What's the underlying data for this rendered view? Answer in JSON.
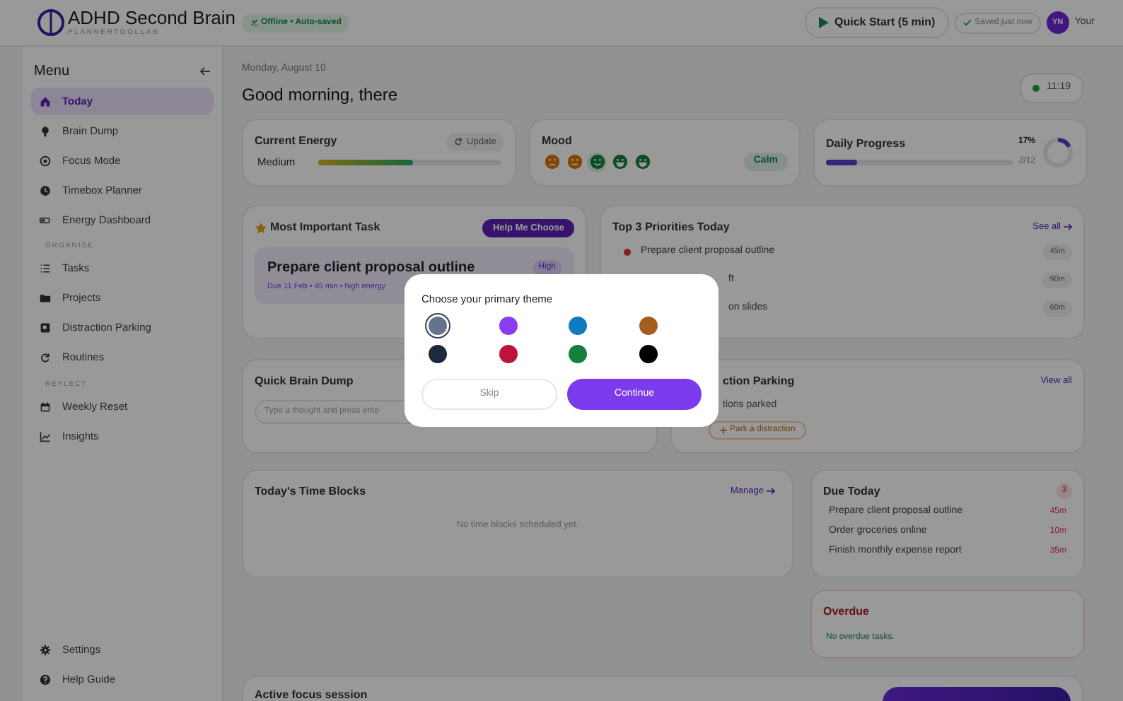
{
  "header": {
    "app_title": "ADHD Second Brain",
    "app_subtitle": "PLANNERTOOLLAB",
    "status_badge": "Offline • Auto-saved",
    "quick_start": "Quick Start (5 min)",
    "save_status": "Saved just now",
    "avatar_initials": "YN",
    "user_name": "Your"
  },
  "sidebar": {
    "title": "Menu",
    "sections": [
      {
        "items": [
          {
            "label": "Today",
            "selected": true
          },
          {
            "label": "Brain Dump",
            "selected": false
          },
          {
            "label": "Focus Mode",
            "selected": false
          },
          {
            "label": "Timebox Planner",
            "selected": false
          },
          {
            "label": "Energy Dashboard",
            "selected": false
          }
        ]
      },
      {
        "heading": "ORGANISE",
        "items": [
          {
            "label": "Tasks",
            "selected": false
          },
          {
            "label": "Projects",
            "selected": false
          },
          {
            "label": "Distraction Parking",
            "selected": false
          },
          {
            "label": "Routines",
            "selected": false
          }
        ]
      },
      {
        "heading": "REFLECT",
        "items": [
          {
            "label": "Weekly Reset",
            "selected": false
          },
          {
            "label": "Insights",
            "selected": false
          }
        ]
      }
    ],
    "footer_items": [
      {
        "label": "Settings",
        "selected": false
      },
      {
        "label": "Help Guide",
        "selected": false
      }
    ]
  },
  "main": {
    "date": "Monday, August 10",
    "greeting": "Good morning, there",
    "clock": "11:19",
    "energy": {
      "title": "Current Energy",
      "update_button": "Update",
      "level_label": "Medium",
      "level": 0.52
    },
    "mood": {
      "title": "Mood",
      "current": "Calm",
      "faces": [
        {
          "kind": "sad",
          "selected": false
        },
        {
          "kind": "meh",
          "selected": false
        },
        {
          "kind": "smile",
          "selected": true
        },
        {
          "kind": "grin",
          "selected": false
        },
        {
          "kind": "grin",
          "selected": false
        }
      ]
    },
    "progress": {
      "title": "Daily Progress",
      "percent": "17%",
      "count": "2/12",
      "level": 0.17
    },
    "most_important_task": {
      "title": "Most Important Task",
      "help_button": "Help Me Choose",
      "task": {
        "name": "Prepare client proposal outline",
        "priority": "High",
        "meta": "Due 11 Feb • 45 min • high energy"
      }
    },
    "priorities": {
      "title": "Top 3 Priorities Today",
      "see_all": "See all",
      "items": [
        {
          "text": "Prepare client proposal outline",
          "duration": "45m",
          "flagged": true
        },
        {
          "text": "ft",
          "duration": "90m",
          "flagged": false
        },
        {
          "text": "on slides",
          "duration": "60m",
          "flagged": false
        }
      ]
    },
    "brain_dump": {
      "title": "Quick Brain Dump",
      "placeholder": "Type a thought and press ente"
    },
    "distraction_parking": {
      "title": "ction Parking",
      "view_all": "View all",
      "summary": "tions parked",
      "park_button": "Park a distraction"
    },
    "time_blocks": {
      "title": "Today's Time Blocks",
      "manage": "Manage",
      "empty": "No time blocks scheduled yet."
    },
    "due_today": {
      "title": "Due Today",
      "count": "3",
      "items": [
        {
          "text": "Prepare client proposal outline",
          "duration": "45m"
        },
        {
          "text": "Order groceries online",
          "duration": "10m"
        },
        {
          "text": "Finish monthly expense report",
          "duration": "35m"
        }
      ]
    },
    "overdue": {
      "title": "Overdue",
      "empty": "No overdue tasks."
    },
    "focus_session": {
      "title": "Active focus session"
    }
  },
  "modal": {
    "title": "Choose your primary theme",
    "swatches": [
      {
        "color": "#64748b",
        "selected": true
      },
      {
        "color": "#8b3cf0",
        "selected": false
      },
      {
        "color": "#0e7abf",
        "selected": false
      },
      {
        "color": "#a65d1c",
        "selected": false
      },
      {
        "color": "#1e293b",
        "selected": false
      },
      {
        "color": "#be123c",
        "selected": false
      },
      {
        "color": "#15803d",
        "selected": false
      },
      {
        "color": "#000000",
        "selected": false
      }
    ],
    "skip": "Skip",
    "continue": "Continue"
  }
}
